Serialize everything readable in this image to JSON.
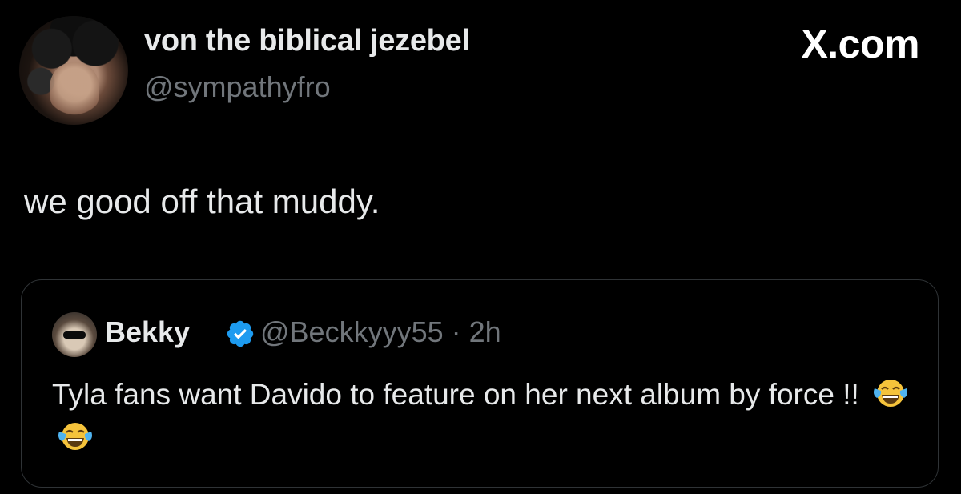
{
  "post": {
    "author_name": "von the biblical jezebel",
    "author_handle": "@sympathyfro",
    "text": "we good off that muddy."
  },
  "brand": {
    "label": "X.com"
  },
  "quoted_post": {
    "author_name": "Bekky",
    "author_handle_and_time": "@Beckkyyy55 · 2h",
    "text": "Tyla fans want Davido to feature on her next album by force !!",
    "emojis": [
      "face-with-tears-of-joy",
      "face-with-tears-of-joy"
    ],
    "verified_color": "#1d9bf0"
  },
  "colors": {
    "background": "#000000",
    "primary_text": "#e7e9ea",
    "secondary_text": "#71767b",
    "card_border": "#2f3336"
  }
}
